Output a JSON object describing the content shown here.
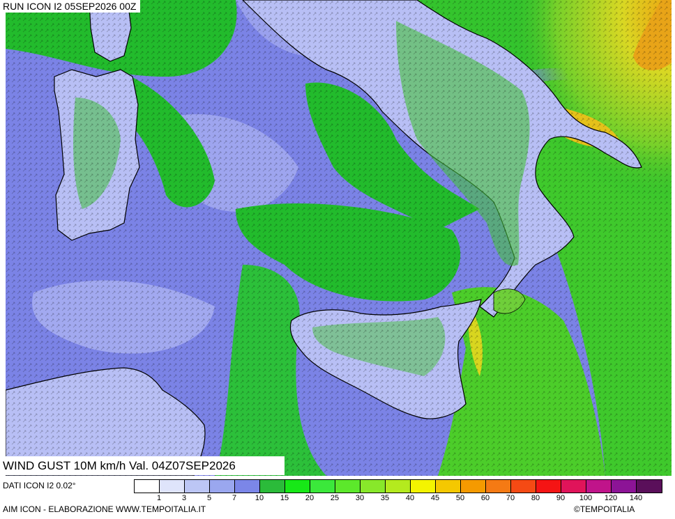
{
  "header": {
    "run_label": "RUN ICON I2 05SEP2026 00Z"
  },
  "map": {
    "valid_label": "WIND GUST 10M km/h Val. 04Z07SEP2026",
    "colors": {
      "sea_low": "#7b83e6",
      "land_light": "#b8bff5",
      "green": "#22bb2c",
      "lime": "#77e81e",
      "yellow": "#e5e01a",
      "orange": "#f0a010",
      "border": "#000000"
    }
  },
  "legend": {
    "data_source": "DATI ICON I2 0.02°",
    "ticks": [
      "1",
      "3",
      "5",
      "7",
      "10",
      "15",
      "20",
      "25",
      "30",
      "35",
      "40",
      "45",
      "50",
      "60",
      "70",
      "80",
      "90",
      "100",
      "120",
      "140"
    ],
    "colors": [
      "#ffffff",
      "#dfe4fb",
      "#bcc6f5",
      "#9aa7ef",
      "#7b86e8",
      "#2bbb3a",
      "#17e817",
      "#3be83b",
      "#5ce82b",
      "#88e82a",
      "#b4ea1e",
      "#f4f400",
      "#f5c800",
      "#f59a00",
      "#f57a14",
      "#f54a14",
      "#f51414",
      "#e0145a",
      "#c0148a",
      "#8c1496",
      "#5a0f5a"
    ]
  },
  "footer": {
    "left": "AIM ICON - ELABORAZIONE WWW.TEMPOITALIA.IT",
    "right": "TEMPOITALIA"
  }
}
